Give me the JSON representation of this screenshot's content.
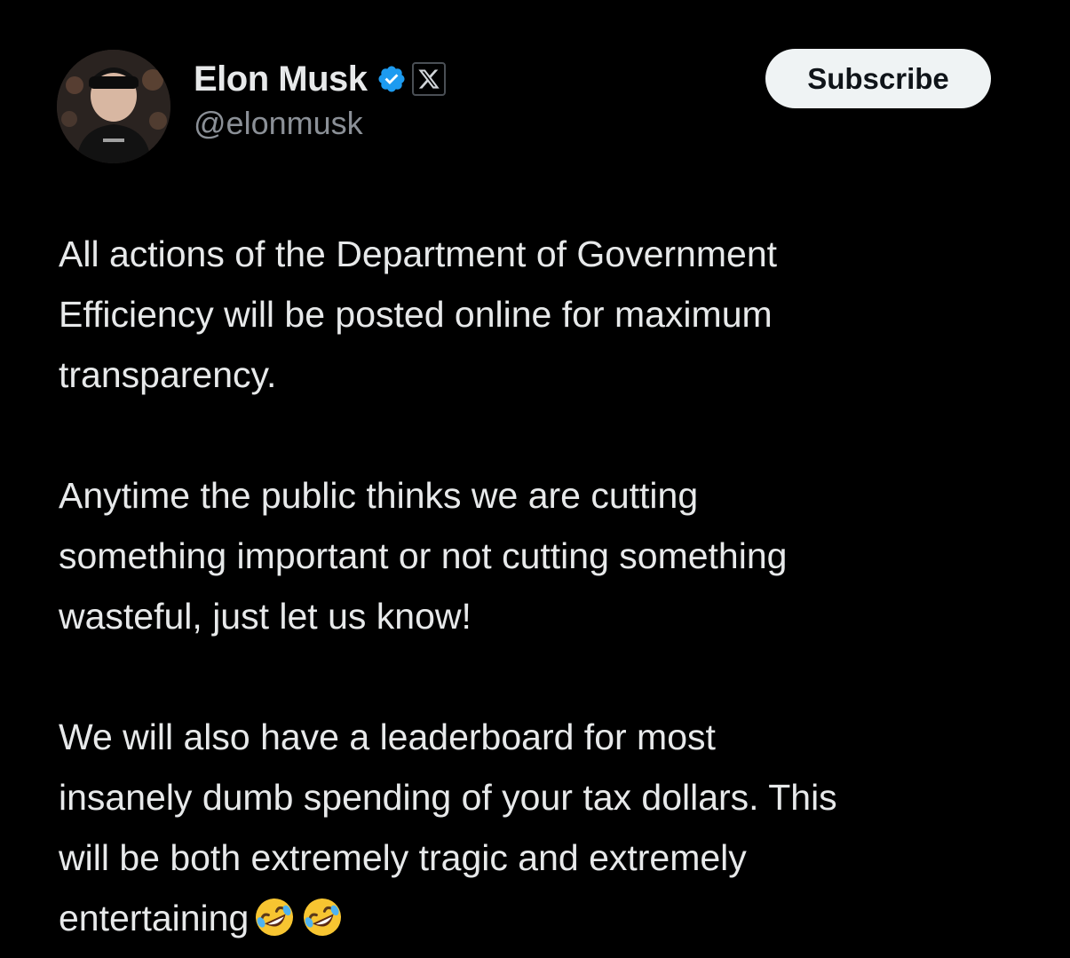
{
  "author": {
    "display_name": "Elon Musk",
    "handle": "@elonmusk",
    "verified_icon": "verified-badge-icon",
    "affiliate_icon": "x-logo-icon"
  },
  "actions": {
    "subscribe_label": "Subscribe"
  },
  "post": {
    "paragraphs": [
      "All actions of the Department of Government\nEfficiency will be posted online for maximum\ntransparency.",
      "Anytime the public thinks we are cutting\nsomething important or not cutting something\nwasteful, just let us know!",
      "We will also have a leaderboard for most\ninsanely dumb spending of your tax dollars. This\nwill be both extremely tragic and extremely\nentertaining"
    ],
    "trailing_emojis": [
      "rolling-on-floor-laughing-emoji",
      "rolling-on-floor-laughing-emoji"
    ]
  },
  "colors": {
    "background": "#000000",
    "text_primary": "#e7e9ea",
    "text_secondary": "#8b9097",
    "verified_blue": "#1d9bf0",
    "button_bg": "#eff3f4"
  }
}
